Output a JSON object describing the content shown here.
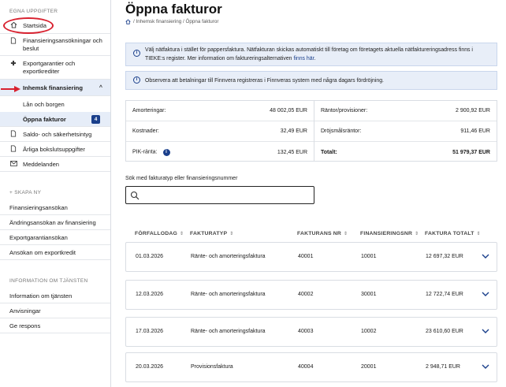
{
  "sidebar": {
    "section_own": "EGNA UPPGIFTER",
    "items": [
      {
        "label": "Startsida",
        "icon": "home-icon"
      },
      {
        "label": "Finansieringsansökningar och beslut",
        "icon": "document-icon"
      },
      {
        "label": "Exportgarantier och exportkrediter",
        "icon": "export-icon"
      },
      {
        "label": "Inhemsk finansiering",
        "icon": "chevron-up-icon"
      },
      {
        "label": "Lån och borgen"
      },
      {
        "label": "Öppna fakturor",
        "badge": "4"
      },
      {
        "label": "Saldo- och säkerhetsintyg",
        "icon": "document-icon"
      },
      {
        "label": "Årliga bokslutsuppgifter",
        "icon": "document-icon"
      },
      {
        "label": "Meddelanden",
        "icon": "mail-icon"
      }
    ],
    "section_create": "+ SKAPA NY",
    "create_items": [
      "Finansieringsansökan",
      "Ändringsansökan av finansiering",
      "Exportgarantiansökan",
      "Ansökan om exportkredit"
    ],
    "section_info": "INFORMATION OM TJÄNSTEN",
    "info_items": [
      "Information om tjänsten",
      "Anvisningar",
      "Ge respons"
    ]
  },
  "header": {
    "title": "Öppna fakturor",
    "breadcrumb": "/ Inhemsk finansiering / Öppna fakturor"
  },
  "notices": {
    "einvoice_text": "Välj nätfaktura i stället för pappersfaktura. Nätfakturan skickas automatiskt till företag om företagets aktuella nätfaktureringsadress finns i TIEKE:s register. Mer information om faktureringsalternativen",
    "einvoice_link": "finns här",
    "einvoice_end": ".",
    "payment_text": "Observera att betalningar till Finnvera registreras i Finnveras system med några dagars fördröjning."
  },
  "summary": {
    "amortization_label": "Amorteringar:",
    "amortization_value": "48 002,05 EUR",
    "interest_label": "Räntor/provisioner:",
    "interest_value": "2 900,92 EUR",
    "costs_label": "Kostnader:",
    "costs_value": "32,49 EUR",
    "late_interest_label": "Dröjsmålsräntor:",
    "late_interest_value": "911,46 EUR",
    "pik_label": "PIK-ränta:",
    "pik_value": "132,45 EUR",
    "total_label": "Totalt:",
    "total_value": "51 979,37 EUR"
  },
  "search": {
    "label": "Sök med fakturatyp eller finansieringsnummer",
    "value": "",
    "placeholder": ""
  },
  "table": {
    "columns": [
      "FÖRFALLODAG",
      "FAKTURATYP",
      "FAKTURANS NR",
      "FINANSIERINGSNR",
      "FAKTURA TOTALT"
    ],
    "rows": [
      {
        "due": "01.03.2026",
        "type": "Ränte- och amorteringsfaktura",
        "number": "40001",
        "financing": "10001",
        "total": "12 697,32 EUR"
      },
      {
        "due": "12.03.2026",
        "type": "Ränte- och amorteringsfaktura",
        "number": "40002",
        "financing": "30001",
        "total": "12 722,74 EUR"
      },
      {
        "due": "17.03.2026",
        "type": "Ränte- och amorteringsfaktura",
        "number": "40003",
        "financing": "10002",
        "total": "23 610,60 EUR"
      },
      {
        "due": "20.03.2026",
        "type": "Provisionsfaktura",
        "number": "40004",
        "financing": "20001",
        "total": "2 948,71 EUR"
      }
    ]
  },
  "colors": {
    "accent": "#1a3f8b",
    "annotation": "#d8212f",
    "active_bg": "#e6edf8"
  }
}
